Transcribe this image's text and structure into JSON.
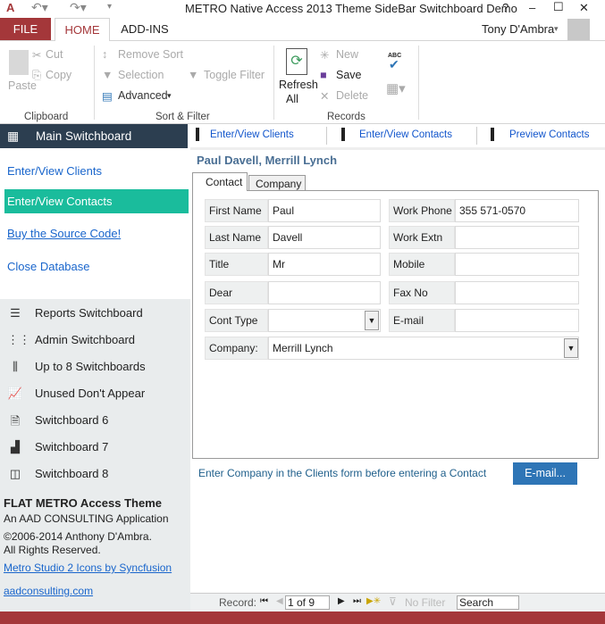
{
  "window": {
    "title": "METRO Native Access 2013 Theme SideBar Switchboard Demo",
    "help": "?",
    "minimize": "–",
    "maximize": "☐",
    "close": "✕",
    "app_icon": "A"
  },
  "ribbon_tabs": [
    "FILE",
    "HOME",
    "ADD-INS"
  ],
  "user": "Tony D'Ambra",
  "ribbon": {
    "clipboard": {
      "label": "Clipboard",
      "paste": "Paste",
      "cut": "Cut",
      "copy": "Copy"
    },
    "sort_filter": {
      "label": "Sort & Filter",
      "remove_sort": "Remove Sort",
      "selection": "Selection",
      "toggle_filter": "Toggle Filter",
      "advanced": "Advanced"
    },
    "records": {
      "label": "Records",
      "refresh": "Refresh",
      "all": "All",
      "new": "New",
      "save": "Save",
      "delete": "Delete",
      "spelling": "ABC"
    }
  },
  "nav": {
    "main": "Main Switchboard",
    "buttons": [
      "Enter/View Clients",
      "Enter/View Contacts",
      "Preview Contacts"
    ]
  },
  "sidebar": {
    "links": [
      "Enter/View Clients",
      "Enter/View Contacts",
      "Buy the Source Code!",
      "Close Database"
    ],
    "switchboards": [
      {
        "label": "Reports Switchboard",
        "icon": "list-pen-icon"
      },
      {
        "label": "Admin Switchboard",
        "icon": "hierarchy-icon"
      },
      {
        "label": "Up to 8 Switchboards",
        "icon": "bars-download-icon"
      },
      {
        "label": "Unused Don't Appear",
        "icon": "chart-growth-icon"
      },
      {
        "label": "Switchboard 6",
        "icon": "document-check-icon"
      },
      {
        "label": "Switchboard 7",
        "icon": "bar-chart-icon"
      },
      {
        "label": "Switchboard 8",
        "icon": "layout-icon"
      }
    ],
    "footer": {
      "title": "FLAT METRO Access Theme",
      "subtitle": "An AAD CONSULTING Application",
      "copyright": "©2006-2014 Anthony D'Ambra.",
      "rights": "All Rights Reserved.",
      "icons_link": "Metro Studio 2 Icons by Syncfusion",
      "site_link": "aadconsulting.com"
    }
  },
  "form": {
    "heading": "Paul Davell, Merrill Lynch",
    "tabs": [
      "Contact",
      "Company"
    ],
    "left": [
      {
        "label": "First Name",
        "value": "Paul"
      },
      {
        "label": "Last Name",
        "value": "Davell"
      },
      {
        "label": "Title",
        "value": "Mr"
      },
      {
        "label": "Dear",
        "value": ""
      },
      {
        "label": "Cont Type",
        "value": ""
      }
    ],
    "right": [
      {
        "label": "Work Phone",
        "value": "355 571-0570"
      },
      {
        "label": "Work Extn",
        "value": ""
      },
      {
        "label": "Mobile",
        "value": ""
      },
      {
        "label": "Fax No",
        "value": ""
      },
      {
        "label": "E-mail",
        "value": ""
      }
    ],
    "company": {
      "label": "Company:",
      "value": "Merrill Lynch"
    },
    "hint": "Enter Company in the Clients form before entering a Contact",
    "email_button": "E-mail..."
  },
  "record_nav": {
    "label": "Record:",
    "current": "1 of 9",
    "no_filter": "No Filter",
    "search": "Search"
  },
  "colors": {
    "accent_red": "#a4373a",
    "nav_dark": "#2c3e50",
    "selected_green": "#1abc9c",
    "link_blue": "#1a66cc",
    "button_blue": "#2e75b6"
  }
}
